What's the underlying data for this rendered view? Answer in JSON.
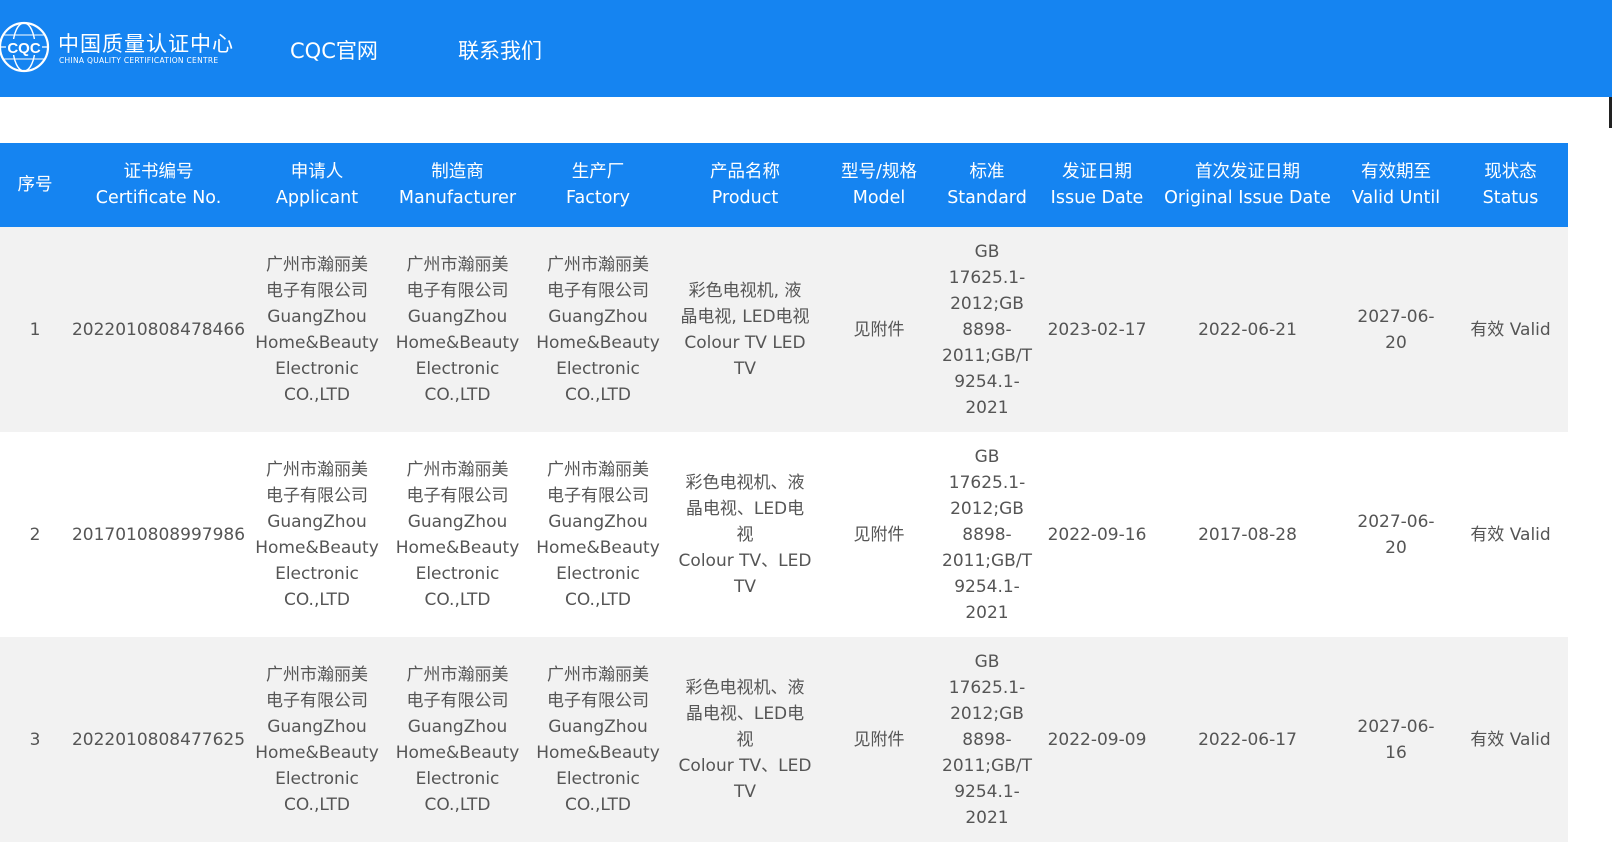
{
  "header": {
    "logo_text_cn": "中国质量认证中心",
    "logo_text_en": "CHINA QUALITY CERTIFICATION CENTRE",
    "nav": [
      "CQC官网",
      "联系我们"
    ],
    "brand_color": "#1584f1"
  },
  "table": {
    "columns": [
      {
        "cn": "序号",
        "en": ""
      },
      {
        "cn": "证书编号",
        "en": "Certificate No."
      },
      {
        "cn": "申请人",
        "en": "Applicant"
      },
      {
        "cn": "制造商",
        "en": "Manufacturer"
      },
      {
        "cn": "生产厂",
        "en": "Factory"
      },
      {
        "cn": "产品名称",
        "en": "Product"
      },
      {
        "cn": "型号/规格",
        "en": "Model"
      },
      {
        "cn": "标准",
        "en": "Standard"
      },
      {
        "cn": "发证日期",
        "en": "Issue Date"
      },
      {
        "cn": "首次发证日期",
        "en": "Original Issue Date"
      },
      {
        "cn": "有效期至",
        "en": "Valid Until"
      },
      {
        "cn": "现状态",
        "en": "Status"
      }
    ],
    "rows": [
      {
        "index": "1",
        "cert_no": "2022010808478466",
        "applicant": "广州市瀚丽美\n电子有限公司\nGuangZhou\nHome&Beauty\nElectronic\nCO.,LTD",
        "manufacturer": "广州市瀚丽美\n电子有限公司\nGuangZhou\nHome&Beauty\nElectronic\nCO.,LTD",
        "factory": "广州市瀚丽美\n电子有限公司\nGuangZhou\nHome&Beauty\nElectronic\nCO.,LTD",
        "product": "彩色电视机, 液\n晶电视, LED电视\nColour TV LED\nTV",
        "model": "见附件",
        "standard": "GB\n17625.1-\n2012;GB\n8898-\n2011;GB/T\n9254.1-\n2021",
        "issue_date": "2023-02-17",
        "original_issue_date": "2022-06-21",
        "valid_until": "2027-06-\n20",
        "status": "有效 Valid"
      },
      {
        "index": "2",
        "cert_no": "2017010808997986",
        "applicant": "广州市瀚丽美\n电子有限公司\nGuangZhou\nHome&Beauty\nElectronic\nCO.,LTD",
        "manufacturer": "广州市瀚丽美\n电子有限公司\nGuangZhou\nHome&Beauty\nElectronic\nCO.,LTD",
        "factory": "广州市瀚丽美\n电子有限公司\nGuangZhou\nHome&Beauty\nElectronic\nCO.,LTD",
        "product": "彩色电视机、液\n晶电视、LED电\n视\nColour TV、LED\nTV",
        "model": "见附件",
        "standard": "GB\n17625.1-\n2012;GB\n8898-\n2011;GB/T\n9254.1-\n2021",
        "issue_date": "2022-09-16",
        "original_issue_date": "2017-08-28",
        "valid_until": "2027-06-\n20",
        "status": "有效 Valid"
      },
      {
        "index": "3",
        "cert_no": "2022010808477625",
        "applicant": "广州市瀚丽美\n电子有限公司\nGuangZhou\nHome&Beauty\nElectronic\nCO.,LTD",
        "manufacturer": "广州市瀚丽美\n电子有限公司\nGuangZhou\nHome&Beauty\nElectronic\nCO.,LTD",
        "factory": "广州市瀚丽美\n电子有限公司\nGuangZhou\nHome&Beauty\nElectronic\nCO.,LTD",
        "product": "彩色电视机、液\n晶电视、LED电\n视\nColour TV、LED\nTV",
        "model": "见附件",
        "standard": "GB\n17625.1-\n2012;GB\n8898-\n2011;GB/T\n9254.1-\n2021",
        "issue_date": "2022-09-09",
        "original_issue_date": "2022-06-17",
        "valid_until": "2027-06-\n16",
        "status": "有效 Valid"
      }
    ]
  }
}
